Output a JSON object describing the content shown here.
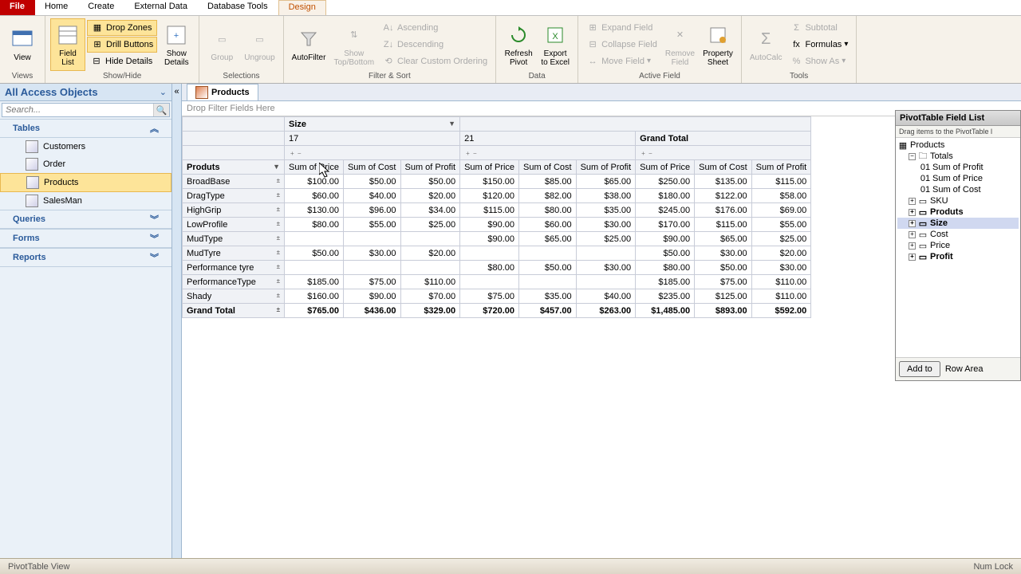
{
  "tabs": {
    "file": "File",
    "home": "Home",
    "create": "Create",
    "external": "External Data",
    "dbtools": "Database Tools",
    "design": "Design"
  },
  "ribbon": {
    "views": {
      "view": "View",
      "title": "Views"
    },
    "showhide": {
      "fieldlist": "Field\nList",
      "dropzones": "Drop Zones",
      "drillbuttons": "Drill Buttons",
      "hidedetails": "Hide Details",
      "showdetails": "Show\nDetails",
      "title": "Show/Hide"
    },
    "selections": {
      "group": "Group",
      "ungroup": "Ungroup",
      "title": "Selections"
    },
    "filtersort": {
      "autofilter": "AutoFilter",
      "showtop": "Show\nTop/Bottom",
      "asc": "Ascending",
      "desc": "Descending",
      "clear": "Clear Custom Ordering",
      "title": "Filter & Sort"
    },
    "data": {
      "refresh": "Refresh\nPivot",
      "export": "Export\nto Excel",
      "title": "Data"
    },
    "activefield": {
      "expand": "Expand Field",
      "collapse": "Collapse Field",
      "move": "Move Field",
      "remove": "Remove\nField",
      "property": "Property\nSheet",
      "title": "Active Field"
    },
    "tools": {
      "autocalc": "AutoCalc",
      "subtotal": "Subtotal",
      "formulas": "Formulas",
      "showas": "Show As",
      "title": "Tools"
    }
  },
  "nav": {
    "title": "All Access Objects",
    "search": "Search...",
    "cats": {
      "tables": "Tables",
      "queries": "Queries",
      "forms": "Forms",
      "reports": "Reports"
    },
    "tables": [
      "Customers",
      "Order",
      "Products",
      "SalesMan"
    ]
  },
  "doc_tab": "Products",
  "filter_zone": "Drop Filter Fields Here",
  "pivot": {
    "col_field": "Size",
    "row_field": "Produts",
    "col_vals": [
      "17",
      "21"
    ],
    "gt": "Grand Total",
    "measures": [
      "Sum of Price",
      "Sum of Cost",
      "Sum of Profit"
    ],
    "rows": [
      {
        "name": "BroadBase",
        "v": [
          "$100.00",
          "$50.00",
          "$50.00",
          "$150.00",
          "$85.00",
          "$65.00",
          "$250.00",
          "$135.00",
          "$115.00"
        ]
      },
      {
        "name": "DragType",
        "v": [
          "$60.00",
          "$40.00",
          "$20.00",
          "$120.00",
          "$82.00",
          "$38.00",
          "$180.00",
          "$122.00",
          "$58.00"
        ]
      },
      {
        "name": "HighGrip",
        "v": [
          "$130.00",
          "$96.00",
          "$34.00",
          "$115.00",
          "$80.00",
          "$35.00",
          "$245.00",
          "$176.00",
          "$69.00"
        ]
      },
      {
        "name": "LowProfile",
        "v": [
          "$80.00",
          "$55.00",
          "$25.00",
          "$90.00",
          "$60.00",
          "$30.00",
          "$170.00",
          "$115.00",
          "$55.00"
        ]
      },
      {
        "name": "MudType",
        "v": [
          "",
          "",
          "",
          "$90.00",
          "$65.00",
          "$25.00",
          "$90.00",
          "$65.00",
          "$25.00"
        ]
      },
      {
        "name": "MudTyre",
        "v": [
          "$50.00",
          "$30.00",
          "$20.00",
          "",
          "",
          "",
          "$50.00",
          "$30.00",
          "$20.00"
        ]
      },
      {
        "name": "Performance tyre",
        "v": [
          "",
          "",
          "",
          "$80.00",
          "$50.00",
          "$30.00",
          "$80.00",
          "$50.00",
          "$30.00"
        ]
      },
      {
        "name": "PerformanceType",
        "v": [
          "$185.00",
          "$75.00",
          "$110.00",
          "",
          "",
          "",
          "$185.00",
          "$75.00",
          "$110.00"
        ]
      },
      {
        "name": "Shady",
        "v": [
          "$160.00",
          "$90.00",
          "$70.00",
          "$75.00",
          "$35.00",
          "$40.00",
          "$235.00",
          "$125.00",
          "$110.00"
        ]
      }
    ],
    "grand": {
      "name": "Grand Total",
      "v": [
        "$765.00",
        "$436.00",
        "$329.00",
        "$720.00",
        "$457.00",
        "$263.00",
        "$1,485.00",
        "$893.00",
        "$592.00"
      ]
    }
  },
  "fieldlist": {
    "title": "PivotTable Field List",
    "sub": "Drag items to the PivotTable l",
    "products": "Products",
    "totals": "Totals",
    "sumprofit": "Sum of Profit",
    "sumprice": "Sum of Price",
    "sumcost": "Sum of Cost",
    "sku": "SKU",
    "produts": "Produts",
    "size": "Size",
    "cost": "Cost",
    "price": "Price",
    "profit": "Profit",
    "addto": "Add to",
    "rowarea": "Row Area"
  },
  "status": {
    "left": "PivotTable View",
    "right": "Num Lock"
  }
}
